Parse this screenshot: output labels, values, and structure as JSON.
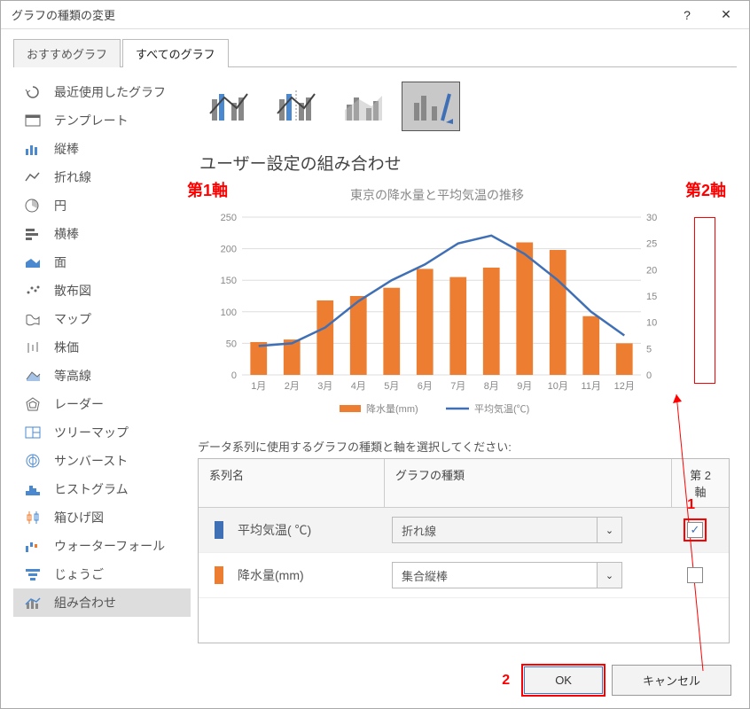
{
  "window": {
    "title": "グラフの種類の変更"
  },
  "tabs": {
    "recommended": "おすすめグラフ",
    "all": "すべてのグラフ"
  },
  "sidebar": {
    "items": [
      {
        "label": "最近使用したグラフ",
        "icon": "history-icon"
      },
      {
        "label": "テンプレート",
        "icon": "template-icon"
      },
      {
        "label": "縦棒",
        "icon": "column-chart-icon"
      },
      {
        "label": "折れ線",
        "icon": "line-chart-icon"
      },
      {
        "label": "円",
        "icon": "pie-chart-icon"
      },
      {
        "label": "横棒",
        "icon": "bar-chart-icon"
      },
      {
        "label": "面",
        "icon": "area-chart-icon"
      },
      {
        "label": "散布図",
        "icon": "scatter-chart-icon"
      },
      {
        "label": "マップ",
        "icon": "map-chart-icon"
      },
      {
        "label": "株価",
        "icon": "stock-chart-icon"
      },
      {
        "label": "等高線",
        "icon": "surface-chart-icon"
      },
      {
        "label": "レーダー",
        "icon": "radar-chart-icon"
      },
      {
        "label": "ツリーマップ",
        "icon": "treemap-icon"
      },
      {
        "label": "サンバースト",
        "icon": "sunburst-icon"
      },
      {
        "label": "ヒストグラム",
        "icon": "histogram-icon"
      },
      {
        "label": "箱ひげ図",
        "icon": "boxplot-icon"
      },
      {
        "label": "ウォーターフォール",
        "icon": "waterfall-icon"
      },
      {
        "label": "じょうご",
        "icon": "funnel-icon"
      },
      {
        "label": "組み合わせ",
        "icon": "combo-chart-icon"
      }
    ]
  },
  "main": {
    "section_title": "ユーザー設定の組み合わせ",
    "subtitle": "データ系列に使用するグラフの種類と軸を選択してください:",
    "grid_headers": {
      "name": "系列名",
      "type": "グラフの種類",
      "axis": "第 2 軸"
    },
    "rows": [
      {
        "name": "平均気温( ℃)",
        "type": "折れ線",
        "axis2": true,
        "color": "#3f6fb5"
      },
      {
        "name": "降水量(mm)",
        "type": "集合縦棒",
        "axis2": false,
        "color": "#ed7d31"
      }
    ]
  },
  "annot": {
    "axis1": "第1軸",
    "axis2": "第2軸",
    "n1": "1",
    "n2": "2"
  },
  "footer": {
    "ok": "OK",
    "cancel": "キャンセル"
  },
  "chart_data": {
    "type": "combo",
    "title": "東京の降水量と平均気温の推移",
    "categories": [
      "1月",
      "2月",
      "3月",
      "4月",
      "5月",
      "6月",
      "7月",
      "8月",
      "9月",
      "10月",
      "11月",
      "12月"
    ],
    "y1_ticks": [
      0,
      50,
      100,
      150,
      200,
      250
    ],
    "y2_ticks": [
      0,
      5,
      10,
      15,
      20,
      25,
      30
    ],
    "legend": {
      "bar": "降水量(mm)",
      "line": "平均気温(℃)"
    },
    "ylim1": [
      0,
      250
    ],
    "ylim2": [
      0,
      30
    ],
    "series": [
      {
        "name": "降水量(mm)",
        "type": "bar",
        "axis": 1,
        "color": "#ed7d31",
        "values": [
          52,
          56,
          118,
          125,
          138,
          168,
          155,
          170,
          210,
          198,
          93,
          50
        ]
      },
      {
        "name": "平均気温(℃)",
        "type": "line",
        "axis": 2,
        "color": "#3f6fb5",
        "values": [
          5.5,
          6,
          9,
          14,
          18,
          21,
          25,
          26.5,
          23,
          18,
          12,
          7.5
        ]
      }
    ]
  }
}
